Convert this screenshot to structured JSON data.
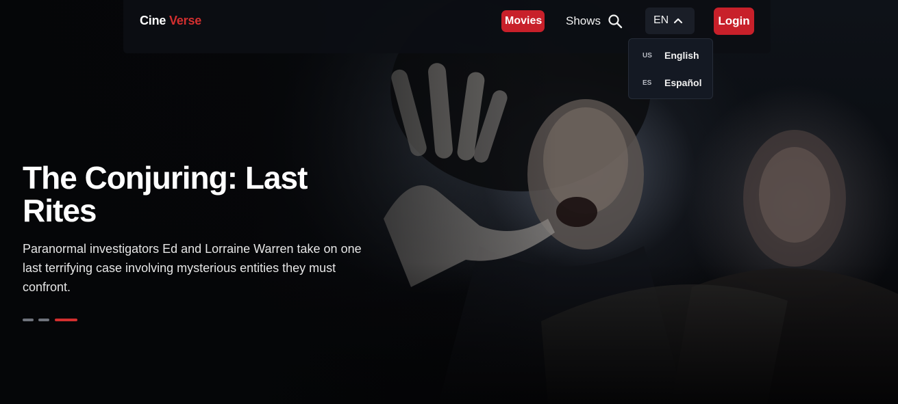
{
  "brand": {
    "name_part1": "Cine",
    "name_part2": "Verse",
    "accent_color": "#d32f2f"
  },
  "nav": {
    "movies_label": "Movies",
    "shows_label": "Shows",
    "search_icon": "search-icon",
    "language_current": "EN",
    "language_chevron_icon": "chevron-up-icon",
    "login_label": "Login"
  },
  "language_menu": {
    "options": [
      {
        "flag": "US",
        "label": "English"
      },
      {
        "flag": "ES",
        "label": "Español"
      }
    ]
  },
  "hero": {
    "title": "The Conjuring: Last Rites",
    "description": "Paranormal investigators Ed and Lorraine Warren take on one last terrifying case involving mysterious entities they must confront.",
    "carousel_total": 3,
    "carousel_active_index": 3
  },
  "colors": {
    "primary_red": "#c8202a",
    "background": "#07080b",
    "nav_bg": "#0c0e13"
  }
}
